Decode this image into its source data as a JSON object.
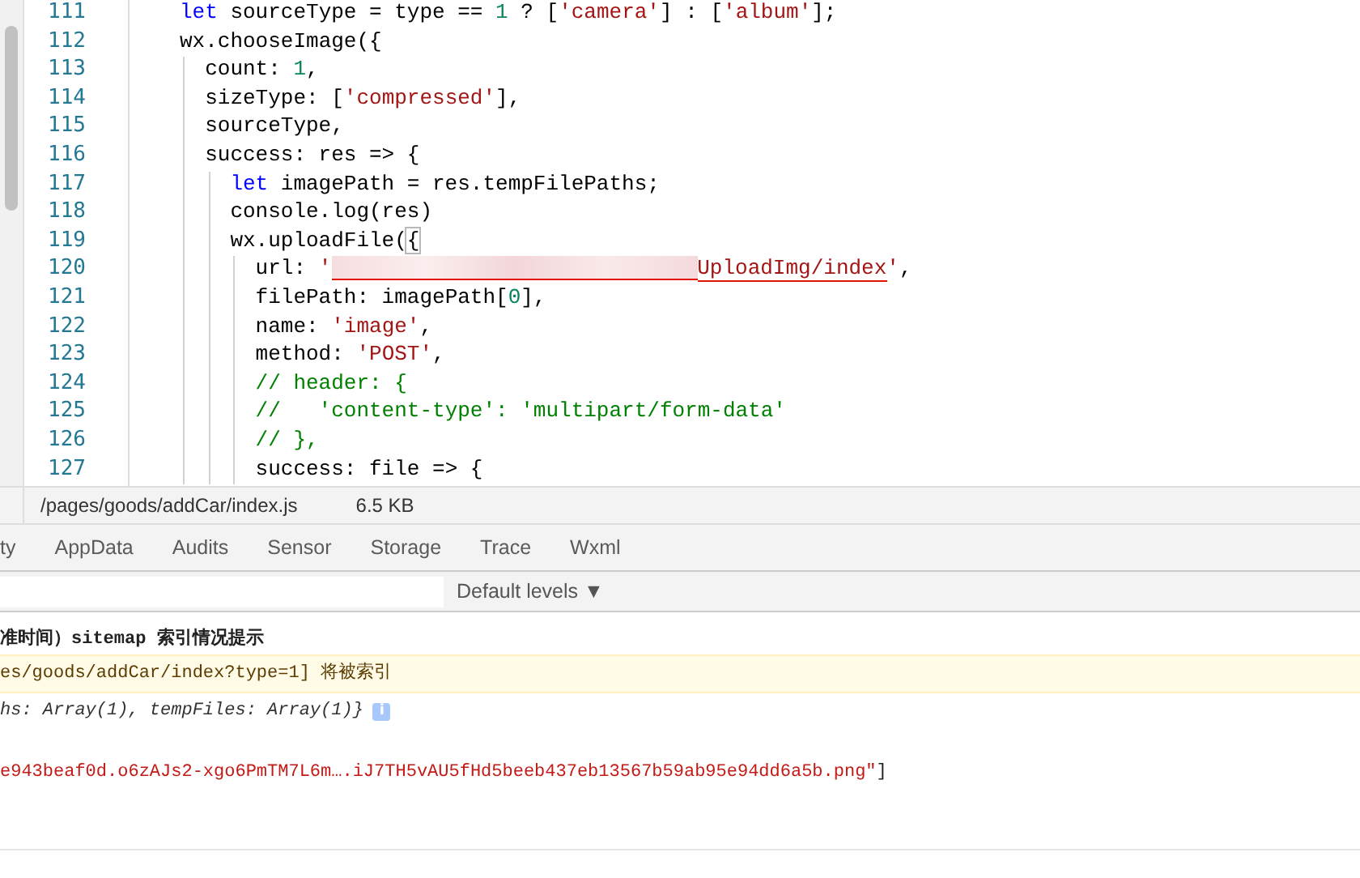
{
  "editor": {
    "lines": [
      {
        "number": "111",
        "tokens": [
          {
            "kind": "kw",
            "text": "let"
          },
          {
            "kind": "plain",
            "text": " sourceType = type == "
          },
          {
            "kind": "num",
            "text": "1"
          },
          {
            "kind": "plain",
            "text": " ? ["
          },
          {
            "kind": "str",
            "text": "'camera'"
          },
          {
            "kind": "plain",
            "text": "] : ["
          },
          {
            "kind": "str",
            "text": "'album'"
          },
          {
            "kind": "plain",
            "text": "];"
          }
        ]
      },
      {
        "number": "112",
        "tokens": [
          {
            "kind": "plain",
            "text": "wx.chooseImage({"
          }
        ],
        "children": [
          {
            "number": "113",
            "tokens": [
              {
                "kind": "plain",
                "text": "count: "
              },
              {
                "kind": "num",
                "text": "1"
              },
              {
                "kind": "plain",
                "text": ","
              }
            ]
          },
          {
            "number": "114",
            "tokens": [
              {
                "kind": "plain",
                "text": "sizeType: ["
              },
              {
                "kind": "str",
                "text": "'compressed'"
              },
              {
                "kind": "plain",
                "text": "],"
              }
            ]
          },
          {
            "number": "115",
            "tokens": [
              {
                "kind": "plain",
                "text": "sourceType,"
              }
            ]
          },
          {
            "number": "116",
            "tokens": [
              {
                "kind": "plain",
                "text": "success: res => {"
              }
            ],
            "children": [
              {
                "number": "117",
                "tokens": [
                  {
                    "kind": "kw",
                    "text": "let"
                  },
                  {
                    "kind": "plain",
                    "text": " imagePath = res.tempFilePaths;"
                  }
                ]
              },
              {
                "number": "118",
                "tokens": [
                  {
                    "kind": "plain",
                    "text": "console.log(res)"
                  }
                ]
              },
              {
                "number": "119",
                "tokens": [
                  {
                    "kind": "plain",
                    "text": "wx.uploadFile("
                  },
                  {
                    "kind": "match",
                    "text": "{"
                  }
                ],
                "children": [
                  {
                    "number": "120",
                    "tokens": [
                      {
                        "kind": "plain",
                        "text": "url: "
                      },
                      {
                        "kind": "str",
                        "text": "'"
                      },
                      {
                        "kind": "redacted"
                      },
                      {
                        "kind": "error",
                        "text": "UploadImg/index"
                      },
                      {
                        "kind": "str",
                        "text": "'"
                      },
                      {
                        "kind": "plain",
                        "text": ","
                      }
                    ]
                  },
                  {
                    "number": "121",
                    "tokens": [
                      {
                        "kind": "plain",
                        "text": "filePath: imagePath["
                      },
                      {
                        "kind": "num",
                        "text": "0"
                      },
                      {
                        "kind": "plain",
                        "text": "],"
                      }
                    ]
                  },
                  {
                    "number": "122",
                    "tokens": [
                      {
                        "kind": "plain",
                        "text": "name: "
                      },
                      {
                        "kind": "str",
                        "text": "'image'"
                      },
                      {
                        "kind": "plain",
                        "text": ","
                      }
                    ]
                  },
                  {
                    "number": "123",
                    "tokens": [
                      {
                        "kind": "plain",
                        "text": "method: "
                      },
                      {
                        "kind": "str",
                        "text": "'POST'"
                      },
                      {
                        "kind": "plain",
                        "text": ","
                      }
                    ]
                  },
                  {
                    "number": "124",
                    "tokens": [
                      {
                        "kind": "comment",
                        "text": "// header: {"
                      }
                    ]
                  },
                  {
                    "number": "125",
                    "tokens": [
                      {
                        "kind": "comment",
                        "text": "//   'content-type': 'multipart/form-data'"
                      }
                    ]
                  },
                  {
                    "number": "126",
                    "tokens": [
                      {
                        "kind": "comment",
                        "text": "// },"
                      }
                    ]
                  },
                  {
                    "number": "127",
                    "tokens": [
                      {
                        "kind": "plain",
                        "text": "success: file => {"
                      }
                    ]
                  }
                ]
              }
            ]
          }
        ]
      }
    ]
  },
  "status_bar": {
    "path": "/pages/goods/addCar/index.js",
    "size": "6.5 KB"
  },
  "tabs": [
    {
      "label": "ty",
      "selected": false
    },
    {
      "label": "AppData",
      "selected": false
    },
    {
      "label": "Audits",
      "selected": false
    },
    {
      "label": "Sensor",
      "selected": false
    },
    {
      "label": "Storage",
      "selected": false
    },
    {
      "label": "Trace",
      "selected": false
    },
    {
      "label": "Wxml",
      "selected": false
    }
  ],
  "filter": {
    "levels": "Default levels",
    "caret": "▼"
  },
  "console": [
    {
      "kind": "header",
      "text": "准时间）sitemap 索引情况提示"
    },
    {
      "kind": "warning",
      "text": "es/goods/addCar/index?type=1] 将被索引"
    },
    {
      "kind": "object",
      "text": "hs: Array(1), tempFiles: Array(1)}",
      "badge": "i"
    },
    {
      "kind": "blank"
    },
    {
      "kind": "string",
      "text": "e943beaf0d.o6zAJs2-xgo6PmTM7L6m….iJ7TH5vAU5fHd5beeb437eb13567b59ab95e94dd6a5b.png\"",
      "suffix": "]"
    }
  ]
}
